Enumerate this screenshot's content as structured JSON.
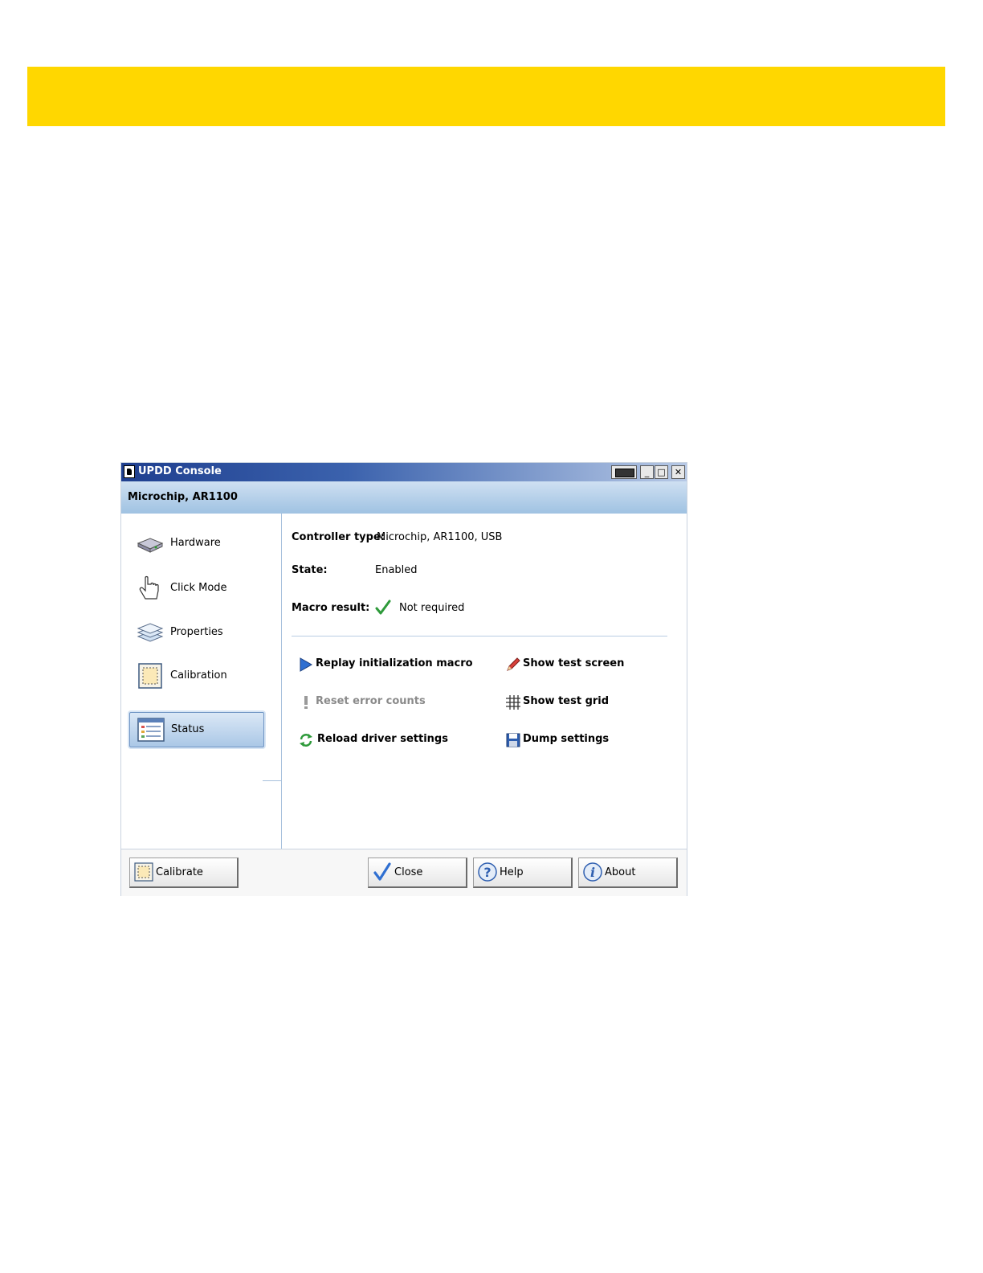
{
  "window": {
    "title": "UPDD Console",
    "device_header": "Microchip, AR1100"
  },
  "sidebar": {
    "items": [
      {
        "label": "Hardware",
        "icon": "hardware-icon"
      },
      {
        "label": "Click Mode",
        "icon": "hand-pointer-icon"
      },
      {
        "label": "Properties",
        "icon": "layers-icon"
      },
      {
        "label": "Calibration",
        "icon": "calibration-icon"
      },
      {
        "label": "Status",
        "icon": "status-icon",
        "selected": true
      }
    ]
  },
  "status": {
    "controller_type_label": "Controller type:",
    "controller_type_value": "Microchip, AR1100, USB",
    "state_label": "State:",
    "state_value": "Enabled",
    "macro_result_label": "Macro result:",
    "macro_result_value": "Not required"
  },
  "actions": [
    {
      "label": "Replay initialization macro",
      "icon": "play-icon",
      "enabled": true
    },
    {
      "label": "Show test screen",
      "icon": "pencil-icon",
      "enabled": true
    },
    {
      "label": "Reset error counts",
      "icon": "exclamation-icon",
      "enabled": false
    },
    {
      "label": "Show test grid",
      "icon": "grid-icon",
      "enabled": true
    },
    {
      "label": "Reload driver settings",
      "icon": "reload-icon",
      "enabled": true
    },
    {
      "label": "Dump settings",
      "icon": "save-icon",
      "enabled": true
    }
  ],
  "footer": {
    "calibrate": "Calibrate",
    "close": "Close",
    "help": "Help",
    "about": "About"
  },
  "colors": {
    "top_band": "#FFD700",
    "titlebar_dark": "#1f3f8f",
    "subheader": "#9fc2e2"
  }
}
